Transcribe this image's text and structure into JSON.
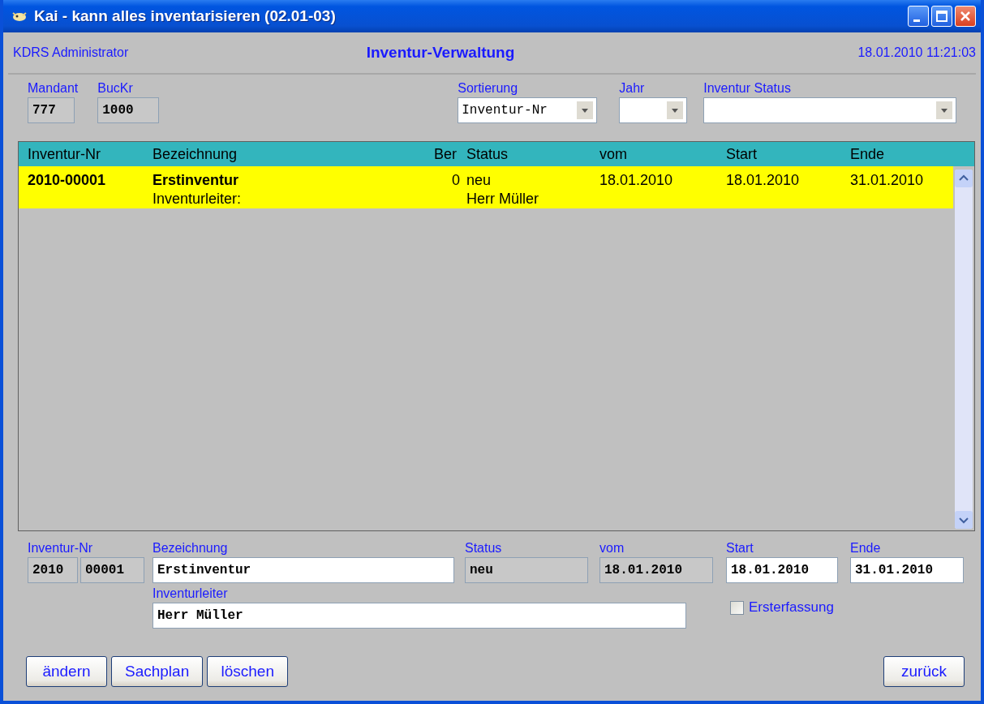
{
  "window": {
    "title": "Kai - kann alles inventarisieren (02.01-03)"
  },
  "header": {
    "user": "KDRS Administrator",
    "title": "Inventur-Verwaltung",
    "datetime": "18.01.2010 11:21:03"
  },
  "filters": [
    {
      "kind": "box",
      "label": "Mandant",
      "value": "777"
    },
    {
      "kind": "box",
      "label": "BucKr",
      "value": "1000"
    },
    {
      "kind": "combo",
      "label": "Sortierung",
      "value": "Inventur-Nr"
    },
    {
      "kind": "combo",
      "label": "Jahr"
    },
    {
      "kind": "combo",
      "label": "Inventur Status"
    }
  ],
  "table": {
    "columns": [
      "Inventur-Nr",
      "Bezeichnung",
      "Ber",
      "Status",
      "vom",
      "Start",
      "Ende"
    ],
    "rows": [
      {
        "selected": true,
        "cells": [
          "2010-00001",
          "Erstinventur",
          "0",
          "neu",
          "18.01.2010",
          "18.01.2010",
          "31.01.2010"
        ],
        "leader_label": "Inventurleiter:",
        "leader": "Herr Müller"
      }
    ]
  },
  "detail": {
    "fields": [
      {
        "label": "Inventur-Nr",
        "values": [
          "2010",
          "00001"
        ],
        "editable": false
      },
      {
        "label": "Bezeichnung",
        "values": [
          "Erstinventur"
        ],
        "editable": true
      },
      {
        "label": "Status",
        "values": [
          "neu"
        ],
        "editable": false
      },
      {
        "label": "vom",
        "values": [
          "18.01.2010"
        ],
        "editable": false
      },
      {
        "label": "Start",
        "values": [
          "18.01.2010"
        ],
        "editable": true
      },
      {
        "label": "Ende",
        "values": [
          "31.01.2010"
        ],
        "editable": true
      }
    ],
    "leader": {
      "label": "Inventurleiter",
      "value": "Herr Müller"
    },
    "checkbox": {
      "label": "Ersterfassung",
      "checked": false
    }
  },
  "left_buttons": [
    "ändern",
    "Sachplan",
    "löschen"
  ],
  "right_buttons": [
    "zurück"
  ]
}
